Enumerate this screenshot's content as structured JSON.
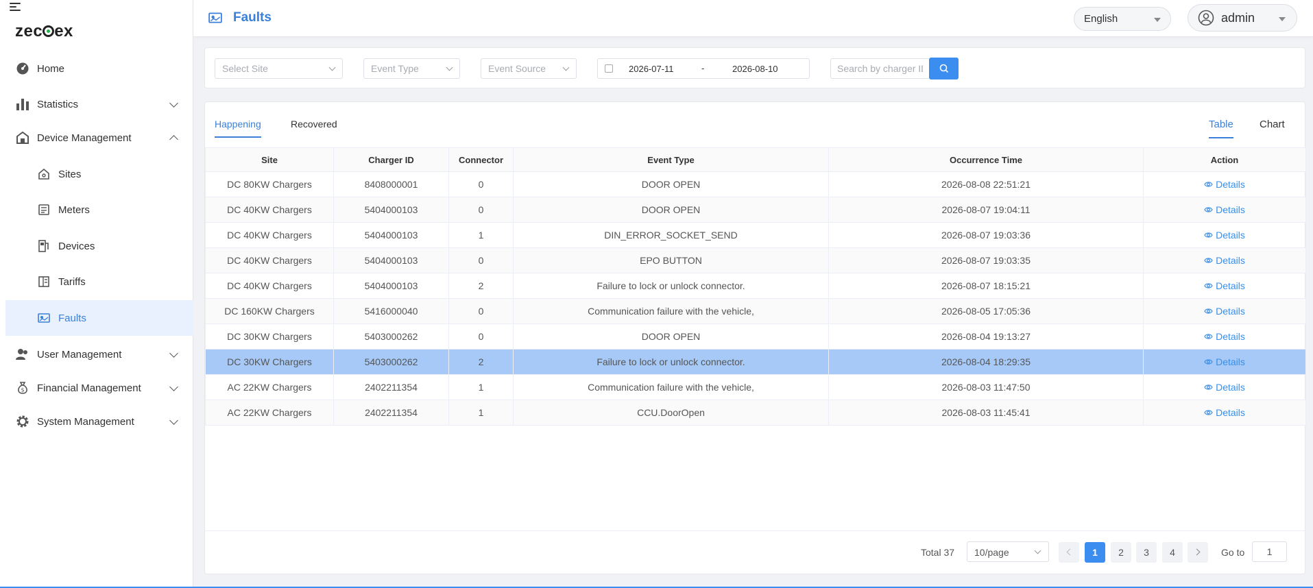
{
  "app": {
    "logo": "zeco",
    "logo_rest": "ex"
  },
  "sidebar": {
    "home": "Home",
    "statistics": "Statistics",
    "device_management": "Device Management",
    "sites": "Sites",
    "meters": "Meters",
    "devices": "Devices",
    "tariffs": "Tariffs",
    "faults": "Faults",
    "user_management": "User Management",
    "financial_management": "Financial Management",
    "system_management": "System Management"
  },
  "header": {
    "title": "Faults",
    "language": "English",
    "user": "admin"
  },
  "filters": {
    "site_placeholder": "Select Site",
    "event_type_placeholder": "Event Type",
    "event_source_placeholder": "Event Source",
    "date_start": "2026-07-11",
    "date_sep": "-",
    "date_end": "2026-08-10",
    "search_placeholder": "Search by charger ID"
  },
  "tabs": {
    "happening": "Happening",
    "recovered": "Recovered",
    "table": "Table",
    "chart": "Chart"
  },
  "table": {
    "headers": {
      "site": "Site",
      "charger_id": "Charger ID",
      "connector": "Connector",
      "event_type": "Event Type",
      "occurrence_time": "Occurrence Time",
      "action": "Action"
    },
    "action_label": "Details",
    "rows": [
      {
        "site": "DC 80KW Chargers",
        "charger_id": "8408000001",
        "connector": "0",
        "event_type": "DOOR OPEN",
        "time": "2026-08-08 22:51:21"
      },
      {
        "site": "DC 40KW Chargers",
        "charger_id": "5404000103",
        "connector": "0",
        "event_type": "DOOR OPEN",
        "time": "2026-08-07 19:04:11"
      },
      {
        "site": "DC 40KW Chargers",
        "charger_id": "5404000103",
        "connector": "1",
        "event_type": "DIN_ERROR_SOCKET_SEND",
        "time": "2026-08-07 19:03:36"
      },
      {
        "site": "DC 40KW Chargers",
        "charger_id": "5404000103",
        "connector": "0",
        "event_type": "EPO BUTTON",
        "time": "2026-08-07 19:03:35"
      },
      {
        "site": "DC 40KW Chargers",
        "charger_id": "5404000103",
        "connector": "2",
        "event_type": "Failure to lock or unlock connector.",
        "time": "2026-08-07 18:15:21"
      },
      {
        "site": "DC 160KW Chargers",
        "charger_id": "5416000040",
        "connector": "0",
        "event_type": "Communication failure with the vehicle,",
        "time": "2026-08-05 17:05:36"
      },
      {
        "site": "DC 30KW Chargers",
        "charger_id": "5403000262",
        "connector": "0",
        "event_type": "DOOR OPEN",
        "time": "2026-08-04 19:13:27"
      },
      {
        "site": "DC 30KW Chargers",
        "charger_id": "5403000262",
        "connector": "2",
        "event_type": "Failure to lock or unlock connector.",
        "time": "2026-08-04 18:29:35"
      },
      {
        "site": "AC 22KW Chargers",
        "charger_id": "2402211354",
        "connector": "1",
        "event_type": "Communication failure with the vehicle,",
        "time": "2026-08-03 11:47:50"
      },
      {
        "site": "AC 22KW Chargers",
        "charger_id": "2402211354",
        "connector": "1",
        "event_type": "CCU.DoorOpen",
        "time": "2026-08-03 11:45:41"
      }
    ]
  },
  "pagination": {
    "total_label": "Total 37",
    "page_size": "10/page",
    "pages": [
      "1",
      "2",
      "3",
      "4"
    ],
    "goto_label": "Go to",
    "goto_value": "1"
  },
  "colors": {
    "accent": "#3a7fd9",
    "primary_button": "#3c8df0",
    "selected_row": "#a6c9f7",
    "active_nav_bg": "#e8f1fd"
  },
  "icons": {
    "home": "dashboard-icon",
    "statistics": "bar-chart-icon",
    "device_management": "building-icon",
    "sites": "house-icon",
    "meters": "meter-icon",
    "devices": "device-icon",
    "tariffs": "tariff-icon",
    "faults": "fault-icon",
    "user_management": "users-icon",
    "financial_management": "money-bag-icon",
    "system_management": "gear-icon",
    "search": "search-icon",
    "details": "eye-icon",
    "user": "user-circle-icon"
  }
}
